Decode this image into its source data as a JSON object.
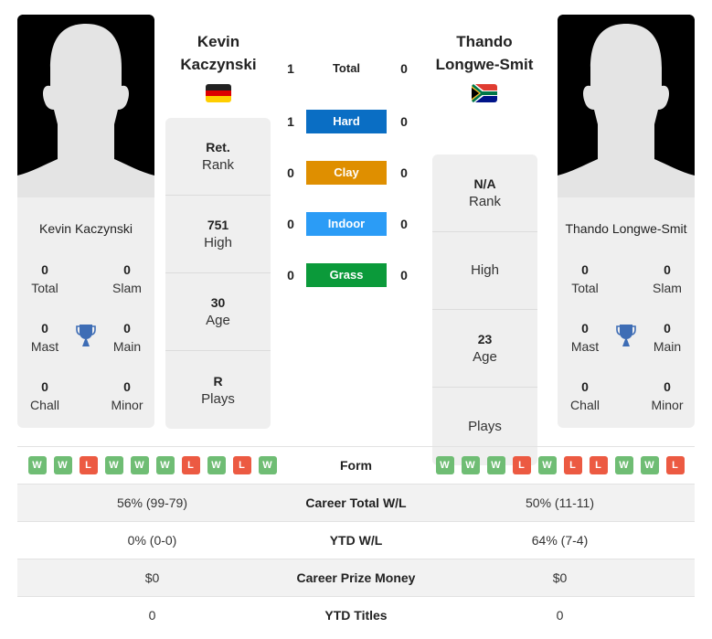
{
  "players": [
    {
      "name": "Kevin Kaczynski",
      "heading_line1": "Kevin",
      "heading_line2": "Kaczynski",
      "flag": "germany-flag",
      "titles": {
        "total": {
          "value": "0",
          "label": "Total"
        },
        "slam": {
          "value": "0",
          "label": "Slam"
        },
        "mast": {
          "value": "0",
          "label": "Mast"
        },
        "main": {
          "value": "0",
          "label": "Main"
        },
        "chall": {
          "value": "0",
          "label": "Chall"
        },
        "minor": {
          "value": "0",
          "label": "Minor"
        }
      },
      "stats": [
        {
          "value": "Ret.",
          "label": "Rank"
        },
        {
          "value": "751",
          "label": "High"
        },
        {
          "value": "30",
          "label": "Age"
        },
        {
          "value": "R",
          "label": "Plays"
        }
      ],
      "form": [
        "W",
        "W",
        "L",
        "W",
        "W",
        "W",
        "L",
        "W",
        "L",
        "W"
      ]
    },
    {
      "name": "Thando Longwe-Smit",
      "heading_line1": "Thando",
      "heading_line2": "Longwe-Smit",
      "flag": "south-africa-flag",
      "titles": {
        "total": {
          "value": "0",
          "label": "Total"
        },
        "slam": {
          "value": "0",
          "label": "Slam"
        },
        "mast": {
          "value": "0",
          "label": "Mast"
        },
        "main": {
          "value": "0",
          "label": "Main"
        },
        "chall": {
          "value": "0",
          "label": "Chall"
        },
        "minor": {
          "value": "0",
          "label": "Minor"
        }
      },
      "stats": [
        {
          "value": "N/A",
          "label": "Rank"
        },
        {
          "value": "",
          "label": "High"
        },
        {
          "value": "23",
          "label": "Age"
        },
        {
          "value": "",
          "label": "Plays"
        }
      ],
      "form": [
        "W",
        "W",
        "W",
        "L",
        "W",
        "L",
        "L",
        "W",
        "W",
        "L"
      ]
    }
  ],
  "h2h": [
    {
      "label": "Total",
      "left": "1",
      "right": "0",
      "color": ""
    },
    {
      "label": "Hard",
      "left": "1",
      "right": "0",
      "color": "#0a6ec4"
    },
    {
      "label": "Clay",
      "left": "0",
      "right": "0",
      "color": "#df8f00"
    },
    {
      "label": "Indoor",
      "left": "0",
      "right": "0",
      "color": "#2b9cf6"
    },
    {
      "label": "Grass",
      "left": "0",
      "right": "0",
      "color": "#0b9a3a"
    }
  ],
  "comparison": {
    "form_label": "Form",
    "rows": [
      {
        "label": "Career Total W/L",
        "left": "56% (99-79)",
        "right": "50% (11-11)"
      },
      {
        "label": "YTD W/L",
        "left": "0% (0-0)",
        "right": "64% (7-4)"
      },
      {
        "label": "Career Prize Money",
        "left": "$0",
        "right": "$0"
      },
      {
        "label": "YTD Titles",
        "left": "0",
        "right": "0"
      }
    ]
  },
  "colors": {
    "win": "#6fbd74",
    "loss": "#ec5a42",
    "trophy": "#3e6db5"
  }
}
